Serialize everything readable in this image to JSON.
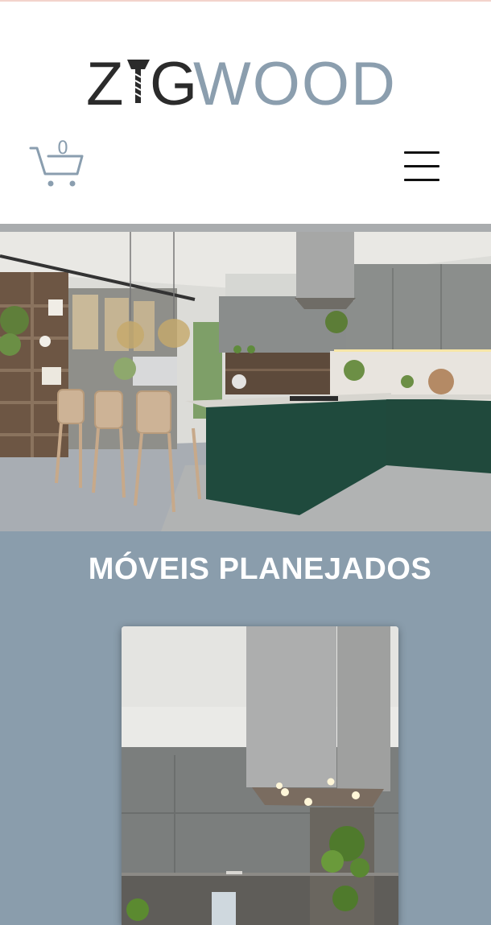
{
  "header": {
    "logo": {
      "brand_dark": "Z",
      "brand_dark_2": "G",
      "brand_light": "WOOD"
    },
    "cart": {
      "count": "0",
      "icon": "cart-icon"
    },
    "menu": {
      "icon": "hamburger-menu-icon"
    }
  },
  "hero": {
    "image": "kitchen-photo"
  },
  "section": {
    "title": "MÓVEIS PLANEJADOS",
    "card_image": "kitchen-hood-photo"
  },
  "colors": {
    "logo_dark": "#2b2b2b",
    "logo_light": "#8b9eae",
    "section_bg": "#8a9dac",
    "divider": "#a9acae"
  }
}
